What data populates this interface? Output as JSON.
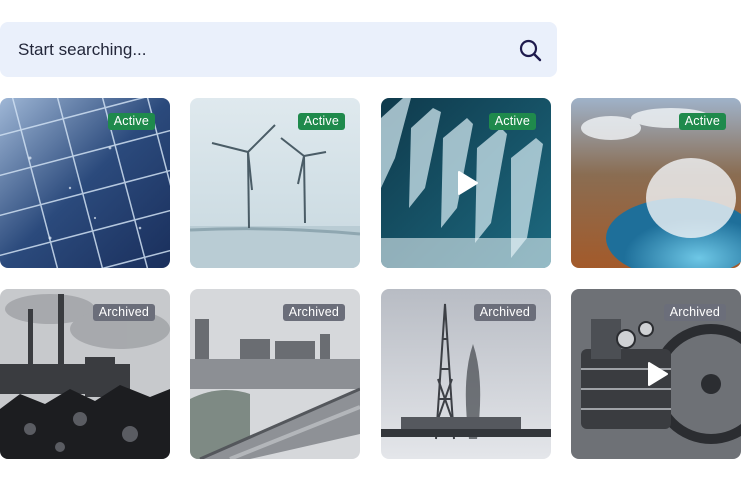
{
  "search": {
    "placeholder": "Start searching...",
    "icon": "search-icon"
  },
  "tiles": [
    {
      "status": "Active",
      "subject": "solar panels",
      "video": false
    },
    {
      "status": "Active",
      "subject": "wind turbines",
      "video": false
    },
    {
      "status": "Active",
      "subject": "hydroelectric dam",
      "video": true
    },
    {
      "status": "Active",
      "subject": "geothermal springs",
      "video": false
    },
    {
      "status": "Archived",
      "subject": "coal power plant",
      "video": false
    },
    {
      "status": "Archived",
      "subject": "oil refinery pipeline",
      "video": false
    },
    {
      "status": "Archived",
      "subject": "oil drilling rig",
      "video": false
    },
    {
      "status": "Archived",
      "subject": "steam engine",
      "video": true
    }
  ],
  "colors": {
    "search_bg": "#eaf0fb",
    "active_badge": "#1f8a4c",
    "archived_badge": "#6b6e7a"
  }
}
